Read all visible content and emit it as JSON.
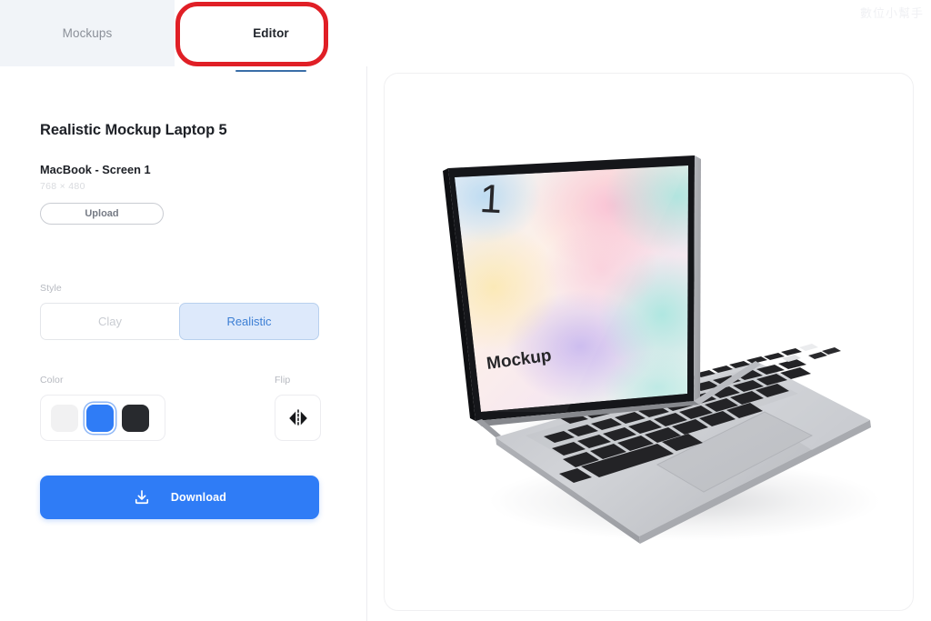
{
  "tabs": [
    {
      "label": "Mockups",
      "active": false
    },
    {
      "label": "Editor",
      "active": true
    }
  ],
  "annotation": {
    "shape": "red-rounded-rectangle",
    "color": "#e01f26",
    "target": "Editor"
  },
  "editor": {
    "title": "Realistic Mockup Laptop 5",
    "screen_name": "MacBook - Screen 1",
    "dimensions": "768 × 480",
    "upload_label": "Upload",
    "style": {
      "label": "Style",
      "options": [
        "Clay",
        "Realistic"
      ],
      "selected": "Realistic"
    },
    "color": {
      "label": "Color",
      "swatches": [
        "#f1f1f2",
        "#2f7cf6",
        "#282a2e"
      ],
      "selected_index": 1
    },
    "flip": {
      "label": "Flip",
      "icon": "flip-horizontal-icon"
    },
    "download_label": "Download",
    "download_icon": "download-icon",
    "accent_color": "#2f7cf6"
  },
  "canvas": {
    "watermark": "數位小幫手",
    "mockup": {
      "device": "MacBook",
      "screen_number": "1",
      "screen_caption": "Mockup",
      "body_color": "#c9cbcf",
      "bezel_color": "#1b1b1d"
    }
  }
}
